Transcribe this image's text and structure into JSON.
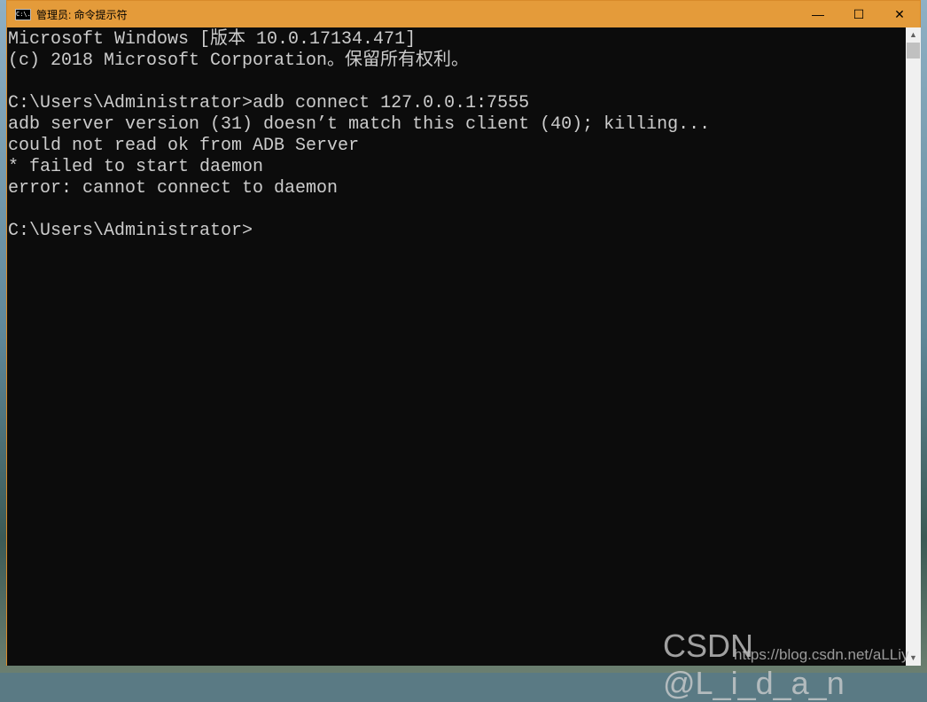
{
  "window": {
    "title": "管理员: 命令提示符",
    "icon_label": "C:\\.",
    "minimize": "—",
    "maximize": "☐",
    "close": "✕"
  },
  "console": {
    "lines": [
      "Microsoft Windows [版本 10.0.17134.471]",
      "(c) 2018 Microsoft Corporation。保留所有权利。",
      "",
      "C:\\Users\\Administrator>adb connect 127.0.0.1:7555",
      "adb server version (31) doesn’t match this client (40); killing...",
      "could not read ok from ADB Server",
      "* failed to start daemon",
      "error: cannot connect to daemon",
      "",
      "C:\\Users\\Administrator>"
    ]
  },
  "scrollbar": {
    "up": "▲",
    "down": "▼"
  },
  "watermark": {
    "main": "CSDN @L_i_d_a_n",
    "url": "https://blog.csdn.net/aLLiy"
  }
}
